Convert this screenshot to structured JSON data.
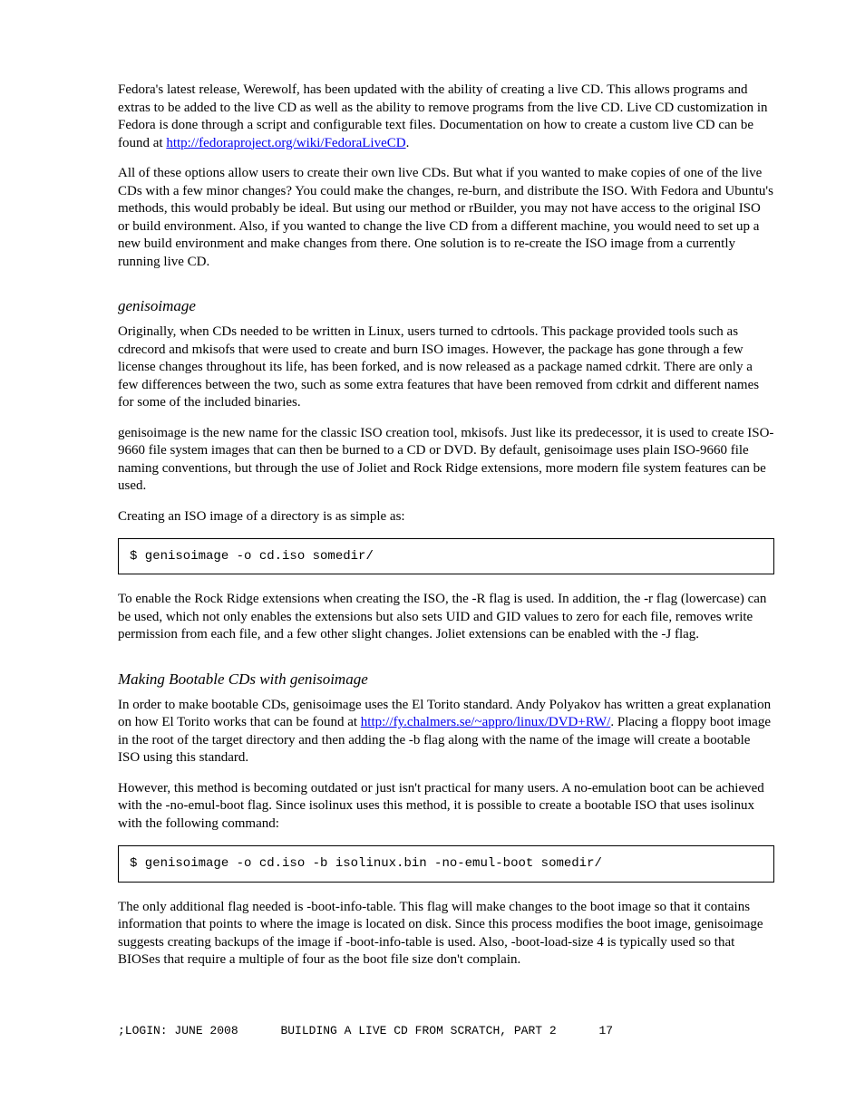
{
  "para1_a": "Fedora's latest release, Werewolf, has been updated with the ability of creating a live CD. This allows programs and extras to be added to the live CD as well as the ability to remove programs from the live CD. Live CD customization in Fedora is done through a script and configurable text files. Documentation on how to create a custom live CD can be found at ",
  "para1_link": "http://fedoraproject.org/wiki/FedoraLiveCD",
  "para1_b": ".",
  "para2": "All of these options allow users to create their own live CDs. But what if you wanted to make copies of one of the live CDs with a few minor changes? You could make the changes, re-burn, and distribute the ISO. With Fedora and Ubuntu's methods, this would probably be ideal. But using our method or rBuilder, you may not have access to the original ISO or build environment. Also, if you wanted to change the live CD from a different machine, you would need to set up a new build environment and make changes from there. One solution is to re-create the ISO image from a currently running live CD.",
  "heading_genisoimage": "genisoimage",
  "para3": "Originally, when CDs needed to be written in Linux, users turned to cdrtools. This package provided tools such as cdrecord and mkisofs that were used to create and burn ISO images. However, the package has gone through a few license changes throughout its life, has been forked, and is now released as a package named cdrkit. There are only a few differences between the two, such as some extra features that have been removed from cdrkit and different names for some of the included binaries.",
  "para4": "genisoimage is the new name for the classic ISO creation tool, mkisofs. Just like its predecessor, it is used to create ISO-9660 file system images that can then be burned to a CD or DVD. By default, genisoimage uses plain ISO-9660 file naming conventions, but through the use of Joliet and Rock Ridge extensions, more modern file system features can be used.",
  "para5": "Creating an ISO image of a directory is as simple as:",
  "code1": "$ genisoimage -o cd.iso somedir/",
  "para6": "To enable the Rock Ridge extensions when creating the ISO, the -R flag is used. In addition, the -r flag (lowercase) can be used, which not only enables the extensions but also sets UID and GID values to zero for each file, removes write permission from each file, and a few other slight changes. Joliet extensions can be enabled with the -J flag.",
  "heading_bootable": "Making Bootable CDs with genisoimage",
  "para7_a": "In order to make bootable CDs, genisoimage uses the El Torito standard. Andy Polyakov has written a great explanation on how El Torito works that can be found at ",
  "para7_link": "http://fy.chalmers.se/~appro/linux/DVD+RW/",
  "para7_b": ". Placing a floppy boot image in the root of the target directory and then adding the -b flag along with the name of the image will create a bootable ISO using this standard.",
  "para8": "However, this method is becoming outdated or just isn't practical for many users. A no-emulation boot can be achieved with the -no-emul-boot flag. Since isolinux uses this method, it is possible to create a bootable ISO that uses isolinux with the following command:",
  "code2": "$ genisoimage -o cd.iso -b isolinux.bin -no-emul-boot somedir/",
  "para9": "The only additional flag needed is -boot-info-table. This flag will make changes to the boot image so that it contains information that points to where the image is located on disk. Since this process modifies the boot image, genisoimage suggests creating backups of the image if -boot-info-table is used. Also, -boot-load-size 4 is typically used so that BIOSes that require a multiple of four as the boot file size don't complain.",
  "footer_left": ";LOGIN:  JUNE 2008",
  "footer_center": "BUILDING A LIVE CD FROM SCRATCH, PART 2",
  "footer_right": "17"
}
